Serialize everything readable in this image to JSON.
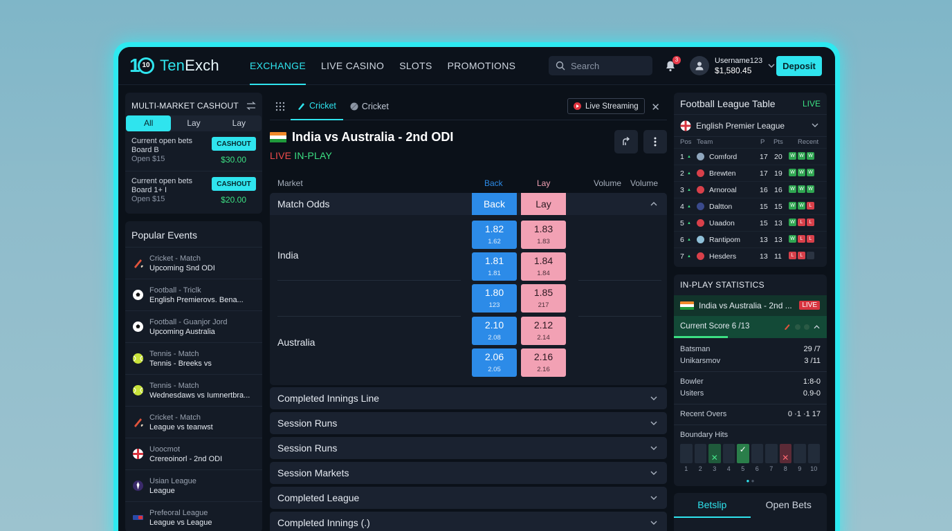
{
  "brand": {
    "name_a": "Ten",
    "name_b": "Exch",
    "mark": "10"
  },
  "nav": [
    "EXCHANGE",
    "LIVE CASINO",
    "SLOTS",
    "PROMOTIONS"
  ],
  "search": {
    "placeholder": "Search"
  },
  "notifications": {
    "count": "3"
  },
  "user": {
    "name": "Username123",
    "balance": "$1,580.45"
  },
  "deposit_label": "Deposit",
  "cashout": {
    "title": "MULTI-MARKET CASHOUT",
    "segments": [
      "All",
      "Lay",
      "Lay"
    ],
    "bets": [
      {
        "title": "Current open bets",
        "sub": "Board B",
        "open": "Open $15",
        "button": "CASHOUT",
        "amount": "$30.00"
      },
      {
        "title": "Current open bets",
        "sub": "Board 1+ I",
        "open": "Open $15",
        "button": "CASHOUT",
        "amount": "$20.00"
      }
    ]
  },
  "popular": {
    "title": "Popular Events",
    "items": [
      {
        "l1": "Cricket - Match",
        "l2": "Upcoming Snd ODI",
        "icon": "cricket-bat-icon"
      },
      {
        "l1": "Football - Triclk",
        "l2": "English Premierovs. Bena...",
        "icon": "football-icon"
      },
      {
        "l1": "Football - Guanjor Jord",
        "l2": "Upcoming Australia",
        "icon": "football-icon"
      },
      {
        "l1": "Tennis - Match",
        "l2": "Tennis - Breeks vs",
        "icon": "tennis-ball-icon"
      },
      {
        "l1": "Tennis - Match",
        "l2": "Wednesdaws vs Iumnertbra...",
        "icon": "tennis-ball-icon"
      },
      {
        "l1": "Cricket - Match",
        "l2": "League vs teanwst",
        "icon": "cricket-bat-icon"
      },
      {
        "l1": "Uoocmot",
        "l2": "Crereoinorl - 2nd ODI",
        "icon": "england-flag-icon"
      },
      {
        "l1": "Usian League",
        "l2": "League",
        "icon": "league-icon"
      },
      {
        "l1": "Prefeoral League",
        "l2": "League vs League",
        "icon": "league-badge-icon"
      }
    ]
  },
  "center": {
    "tabs": [
      "Cricket",
      "Cricket"
    ],
    "stream_label": "Live Streaming",
    "match_title": "India vs Australia - 2nd ODI",
    "live": "LIVE",
    "inplay": "IN-PLAY",
    "market_header": {
      "market": "Market",
      "back": "Back",
      "lay": "Lay",
      "vol1": "Volume",
      "vol2": "Volume"
    },
    "match_odds": {
      "title": "Match Odds",
      "back": "Back",
      "lay": "Lay",
      "runners": [
        "India",
        "Australia"
      ],
      "rows": [
        {
          "back": "1.82",
          "back_sub": "1.62",
          "lay": "1.83",
          "lay_sub": "1.83"
        },
        {
          "back": "1.81",
          "back_sub": "1.81",
          "lay": "1.84",
          "lay_sub": "1.84"
        },
        {
          "back": "1.80",
          "back_sub": "123",
          "lay": "1.85",
          "lay_sub": "217"
        },
        {
          "back": "2.10",
          "back_sub": "2.08",
          "lay": "2.12",
          "lay_sub": "2.14"
        },
        {
          "back": "2.06",
          "back_sub": "2.05",
          "lay": "2.16",
          "lay_sub": "2.16"
        }
      ]
    },
    "markets": [
      "Completed Innings Line",
      "Session Runs",
      "Session Runs",
      "Session Markets",
      "Completed League",
      "Completed Innings (.)"
    ]
  },
  "table": {
    "title": "Football League Table",
    "live": "LIVE",
    "league": "English Premier League",
    "headers": {
      "pos": "Pos",
      "team": "Team",
      "p": "P",
      "pts": "Pts",
      "recent": "Recent"
    },
    "rows": [
      {
        "pos": "1",
        "team": "Comford",
        "p": "17",
        "pts": "20",
        "form": [
          "W",
          "W",
          "W"
        ],
        "color": "#8fa6bd"
      },
      {
        "pos": "2",
        "team": "Brewten",
        "p": "17",
        "pts": "19",
        "form": [
          "W",
          "W",
          "W"
        ],
        "color": "#d8404a"
      },
      {
        "pos": "3",
        "team": "Arnoroal",
        "p": "16",
        "pts": "16",
        "form": [
          "W",
          "W",
          "W"
        ],
        "color": "#d8404a"
      },
      {
        "pos": "4",
        "team": "Daltton",
        "p": "15",
        "pts": "15",
        "form": [
          "W",
          "W",
          "L"
        ],
        "color": "#3a4a8c"
      },
      {
        "pos": "5",
        "team": "Uaadon",
        "p": "15",
        "pts": "13",
        "form": [
          "W",
          "L",
          "L"
        ],
        "color": "#d8404a"
      },
      {
        "pos": "6",
        "team": "Rantipom",
        "p": "13",
        "pts": "13",
        "form": [
          "W",
          "L",
          "L"
        ],
        "color": "#8fc0d8"
      },
      {
        "pos": "7",
        "team": "Hesders",
        "p": "13",
        "pts": "11",
        "form": [
          "L",
          "L",
          ""
        ],
        "color": "#d8404a"
      }
    ]
  },
  "stats": {
    "title": "IN-PLAY STATISTICS",
    "match": "India vs Australia - 2nd ...",
    "live": "LIVE",
    "score": "Current Score 6 /13",
    "batsman_label": "Batsman",
    "batsman_val": "29 /7",
    "bat2_label": "Unikarsmov",
    "bat2_val": "3 /11",
    "bowler_label": "Bowler",
    "bowler_val": "1:8-0",
    "bowl2_label": "Usiters",
    "bowl2_val": "0.9-0",
    "overs_label": "Recent Overs",
    "overs_val": "0  ·1  ·1  17",
    "hits_label": "Boundary Hits",
    "hits": [
      "",
      "",
      "x",
      "",
      "check",
      "",
      "",
      "rx",
      "",
      ""
    ],
    "hit_nums": [
      "1",
      "2",
      "3",
      "4",
      "5",
      "6",
      "7",
      "8",
      "9",
      "10"
    ]
  },
  "betslip": {
    "tab1": "Betslip",
    "tab2": "Open Bets"
  }
}
